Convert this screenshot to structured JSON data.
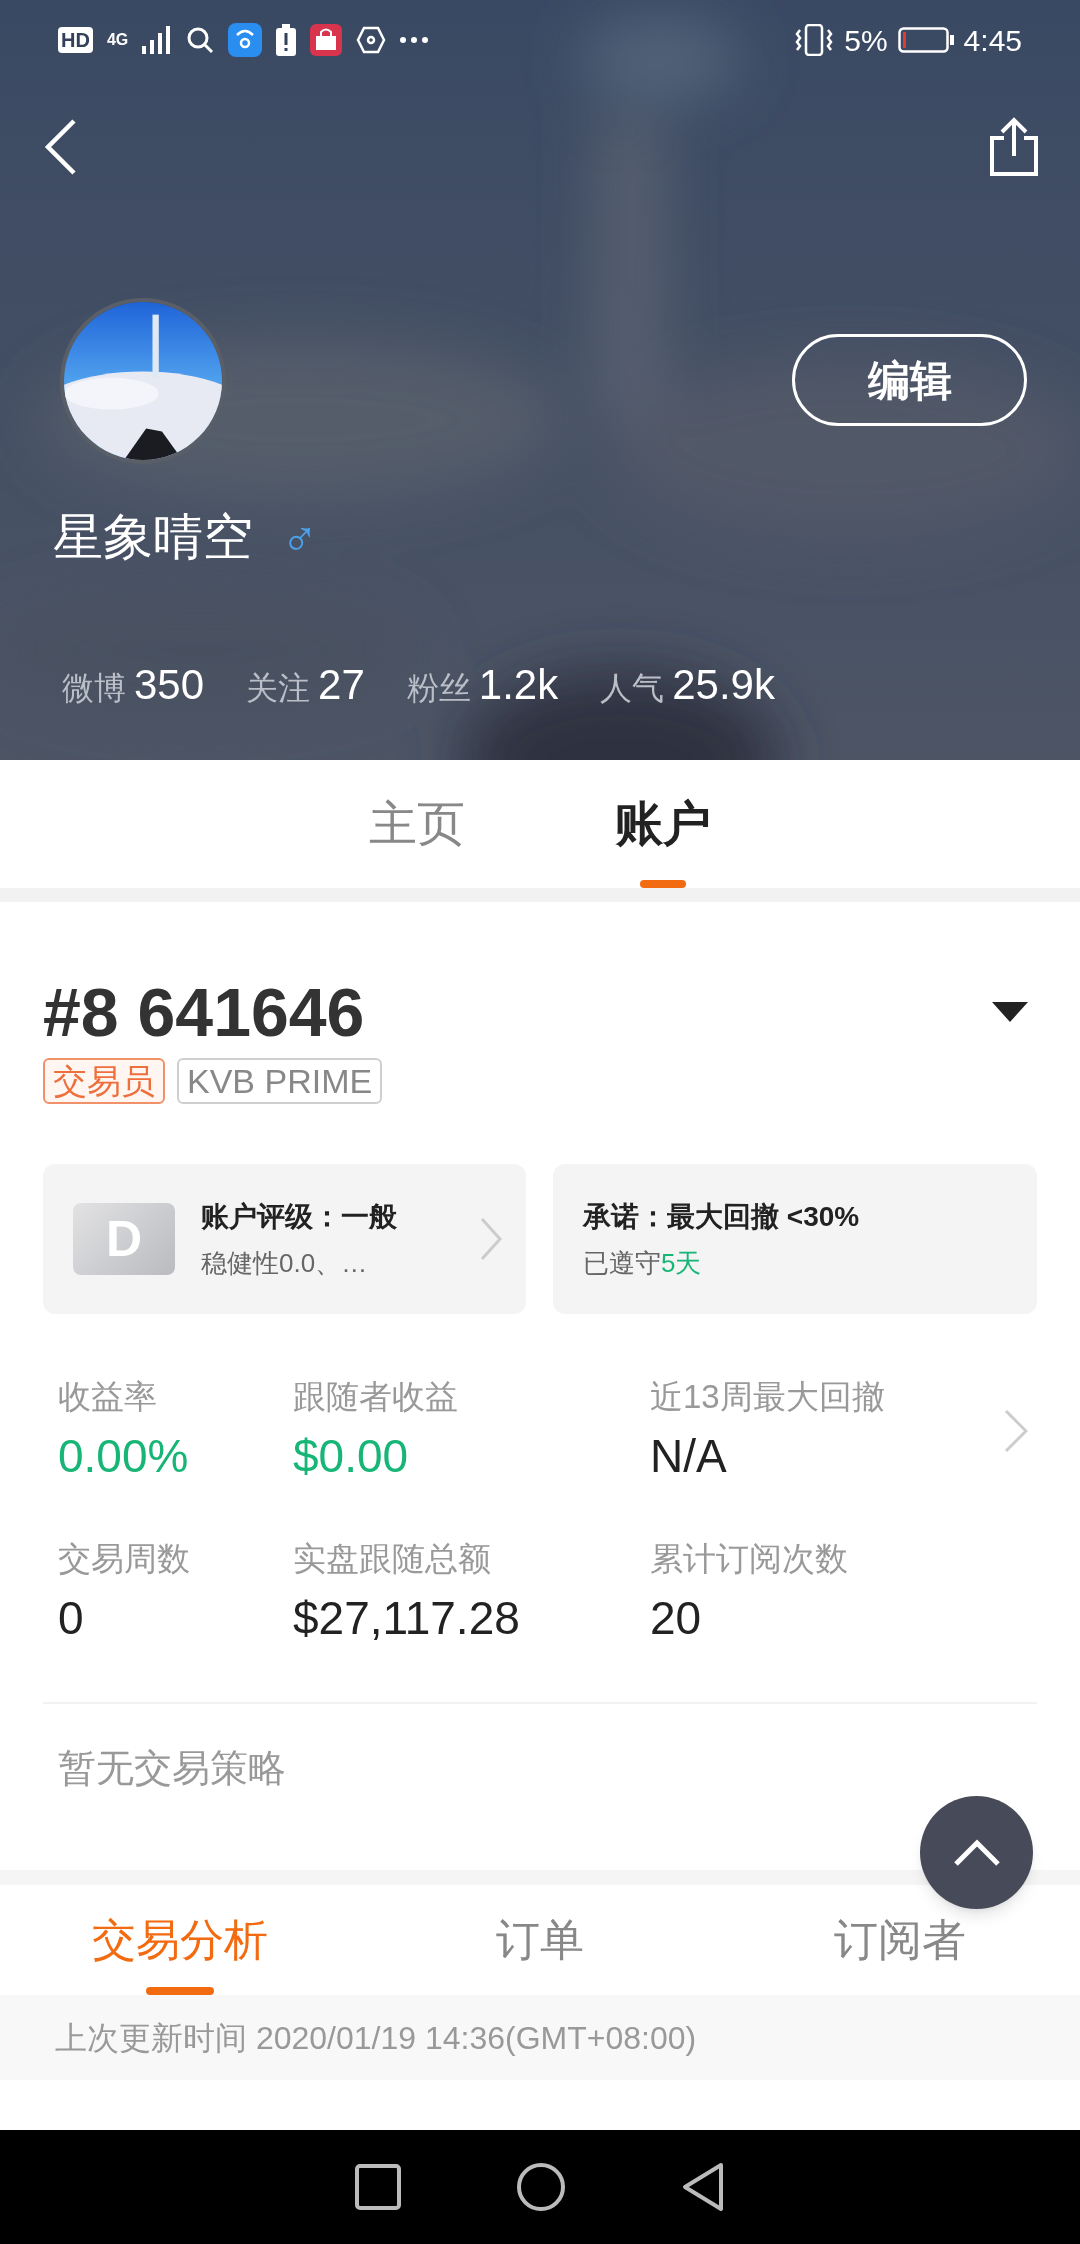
{
  "status_bar": {
    "badges": [
      "HD",
      "4G"
    ],
    "battery": "5%",
    "time": "4:45"
  },
  "profile": {
    "name": "星象晴空",
    "gender_symbol": "♂",
    "edit_button": "编辑",
    "stats": [
      {
        "label": "微博",
        "value": "350"
      },
      {
        "label": "关注",
        "value": "27"
      },
      {
        "label": "粉丝",
        "value": "1.2k"
      },
      {
        "label": "人气",
        "value": "25.9k"
      }
    ]
  },
  "tabs": [
    {
      "label": "主页",
      "selected": false
    },
    {
      "label": "账户",
      "selected": true
    }
  ],
  "account": {
    "number": "#8 641646",
    "tags": [
      {
        "label": "交易员",
        "kind": "role"
      },
      {
        "label": "KVB PRIME",
        "kind": "broker"
      }
    ],
    "rating_card": {
      "grade": "D",
      "title": "账户评级：一般",
      "subtitle": "稳健性0.0、…"
    },
    "commitment_card": {
      "title": "承诺：最大回撤 <30%",
      "status_prefix": "已遵守",
      "status_value": "5天"
    },
    "metrics": [
      {
        "label": "收益率",
        "value": "0.00%",
        "color": "#17b576",
        "link": false
      },
      {
        "label": "跟随者收益",
        "value": "$0.00",
        "color": "#17b576",
        "link": false
      },
      {
        "label": "近13周最大回撤",
        "value": "N/A",
        "color": "#222222",
        "link": true
      },
      {
        "label": "交易周数",
        "value": "0",
        "color": "#222222",
        "link": false
      },
      {
        "label": "实盘跟随总额",
        "value": "$27,117.28",
        "color": "#222222",
        "link": false
      },
      {
        "label": "累计订阅次数",
        "value": "20",
        "color": "#222222",
        "link": false
      }
    ],
    "strategy_note": "暂无交易策略"
  },
  "sub_tabs": [
    {
      "label": "交易分析",
      "selected": true
    },
    {
      "label": "订单",
      "selected": false
    },
    {
      "label": "订阅者",
      "selected": false
    }
  ],
  "update_time": "上次更新时间 2020/01/19 14:36(GMT+08:00)"
}
